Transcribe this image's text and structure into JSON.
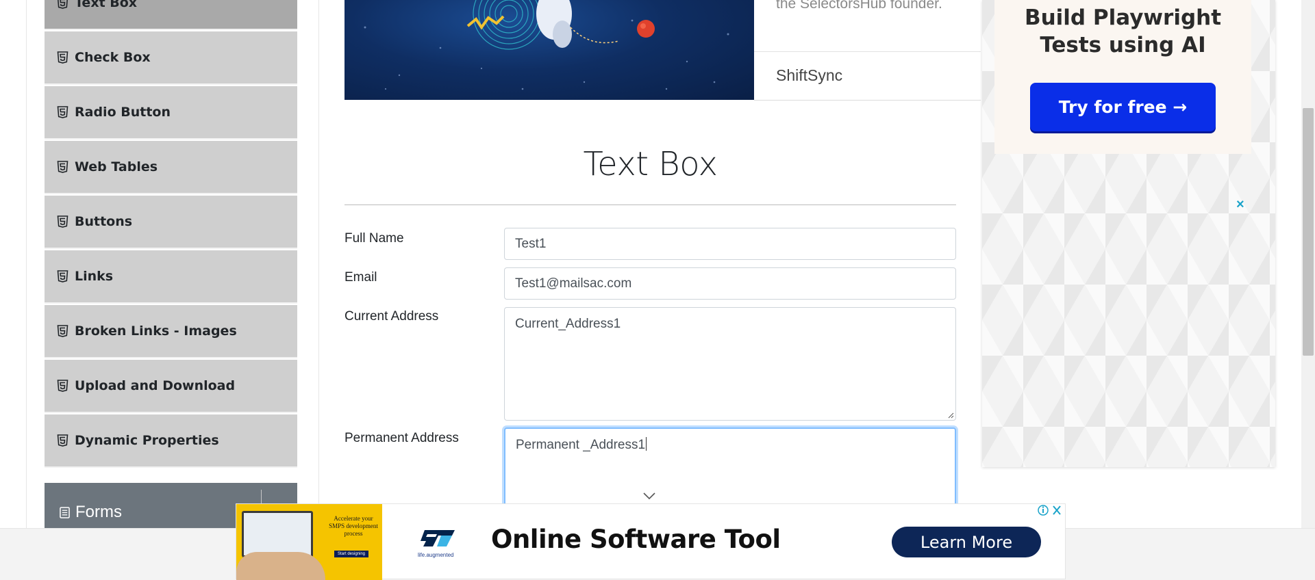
{
  "sidebar": {
    "items": [
      {
        "label": "Text Box",
        "active": true
      },
      {
        "label": "Check Box",
        "active": false
      },
      {
        "label": "Radio Button",
        "active": false
      },
      {
        "label": "Web Tables",
        "active": false
      },
      {
        "label": "Buttons",
        "active": false
      },
      {
        "label": "Links",
        "active": false
      },
      {
        "label": "Broken Links - Images",
        "active": false
      },
      {
        "label": "Upload and Download",
        "active": false
      },
      {
        "label": "Dynamic Properties",
        "active": false
      }
    ],
    "next_group": {
      "label": "Forms",
      "icon": "document-list-icon"
    },
    "item_icon": "html5-icon"
  },
  "banner": {
    "text_line": "the SelectorsHub founder.",
    "company": "ShiftSync"
  },
  "page": {
    "title": "Text Box"
  },
  "form": {
    "full_name": {
      "label": "Full Name",
      "value": "Test1"
    },
    "email": {
      "label": "Email",
      "value": "Test1@mailsac.com"
    },
    "current_address": {
      "label": "Current Address",
      "value": "Current_Address1"
    },
    "permanent_address": {
      "label": "Permanent Address",
      "value": "Permanent _Address1",
      "focused": true
    }
  },
  "right_ad": {
    "title": "Build Playwright Tests using AI",
    "button": "Try for free →",
    "close": "×"
  },
  "bottom_ad": {
    "image_copy": "Accelerate your SMPS development process",
    "image_cta": "Start designing",
    "brand_tagline": "life.augmented",
    "headline": "Online Software Tool",
    "button": "Learn More"
  },
  "colors": {
    "menu_bg": "#cfcfcf",
    "menu_active_bg": "#a9a9a9",
    "group_header_bg": "#6c757d",
    "focus_border": "#80bdff",
    "ad_button_blue": "#0a2ee8",
    "ad_button_navy": "#0d2657",
    "ad_yellow": "#f5c400"
  }
}
